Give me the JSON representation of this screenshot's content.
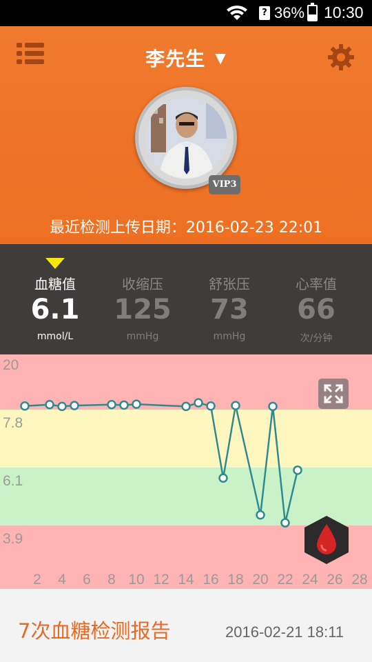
{
  "status_bar": {
    "battery": "36%",
    "time": "10:30"
  },
  "header": {
    "user_name": "李先生",
    "vip_label": "VIP3",
    "last_upload": "最近检测上传日期：2016-02-23 22:01"
  },
  "metrics": [
    {
      "label": "血糖值",
      "value": "6.1",
      "unit": "mmol/L",
      "active": true
    },
    {
      "label": "收缩压",
      "value": "125",
      "unit": "mmHg",
      "active": false
    },
    {
      "label": "舒张压",
      "value": "73",
      "unit": "mmHg",
      "active": false
    },
    {
      "label": "心率值",
      "value": "66",
      "unit": "次/分钟",
      "active": false
    }
  ],
  "chart_data": {
    "type": "line",
    "y_threshold_labels": [
      "20",
      "7.8",
      "6.1",
      "3.9"
    ],
    "x_ticks": [
      "2",
      "4",
      "6",
      "8",
      "10",
      "12",
      "14",
      "16",
      "18",
      "20",
      "22",
      "24",
      "26",
      "28"
    ],
    "zones": [
      {
        "name": "high",
        "from": 7.8,
        "to": 20,
        "color": "#ffb3b3"
      },
      {
        "name": "elevated",
        "from": 6.1,
        "to": 7.8,
        "color": "#fff7bf"
      },
      {
        "name": "normal",
        "from": 3.9,
        "to": 6.1,
        "color": "#c9f2c9"
      },
      {
        "name": "low",
        "from": 0,
        "to": 3.9,
        "color": "#ffb3b3"
      }
    ],
    "x": [
      1,
      3,
      4,
      5,
      8,
      9,
      10,
      14,
      15,
      16,
      17,
      18,
      20,
      21,
      22,
      23
    ],
    "y": [
      8.6,
      8.9,
      8.5,
      8.7,
      8.9,
      8.8,
      9.0,
      8.5,
      9.3,
      8.6,
      5.7,
      8.7,
      4.3,
      8.5,
      4.0,
      6.0
    ],
    "line_color": "#2f8a8f",
    "point_fill": "#ffffff"
  },
  "report": {
    "title": "7次血糖检测报告",
    "time": "2016-02-21 18:11"
  }
}
